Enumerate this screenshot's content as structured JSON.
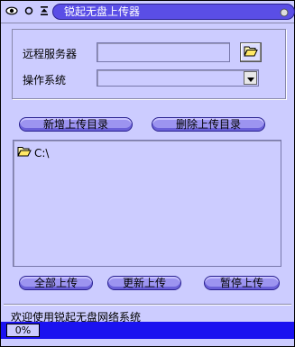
{
  "window": {
    "title": "锐起无盘上传器"
  },
  "form": {
    "server_label": "远程服务器",
    "server_value": "",
    "os_label": "操作系统",
    "os_value": ""
  },
  "buttons": {
    "add_dir": "新增上传目录",
    "del_dir": "删除上传目录",
    "upload_all": "全部上传",
    "update_upload": "更新上传",
    "pause_upload": "暂停上传"
  },
  "tree": {
    "items": [
      {
        "label": "C:\\"
      }
    ]
  },
  "status": {
    "welcome": "欢迎使用锐起无盘网络系统",
    "progress_text": "0%",
    "progress_value": 0
  },
  "colors": {
    "background": "#ccccff",
    "title_pill": "#5a4ee6",
    "status_bar": "#1a12f0",
    "button": "#9c94f0"
  },
  "icons": [
    "eye-icon",
    "circle-icon",
    "sort-icon",
    "menu-icon",
    "folder-open-icon",
    "chevron-down-icon"
  ]
}
